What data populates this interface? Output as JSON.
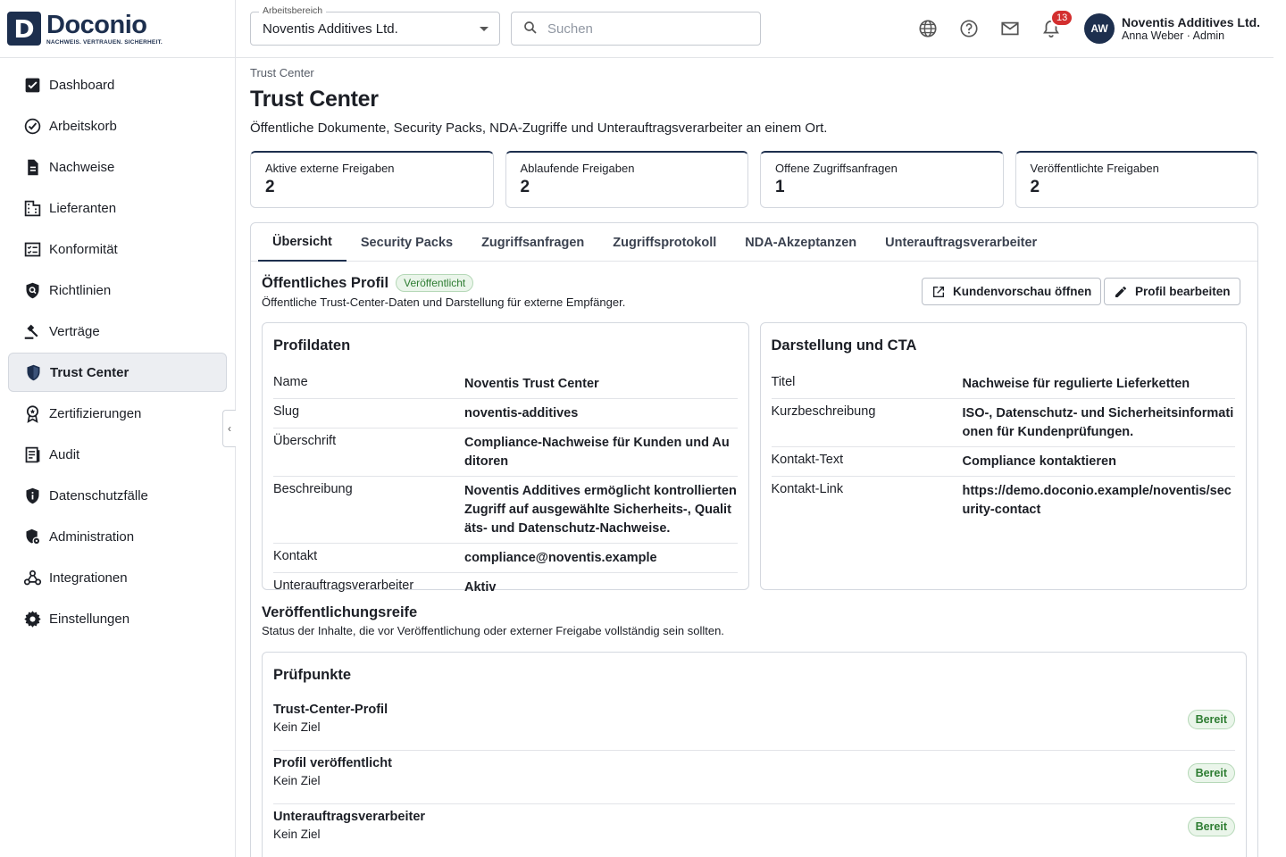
{
  "brand": {
    "mark": "D",
    "name": "Doconio",
    "tagline": "NACHWEIS. VERTRAUEN. SICHERHEIT."
  },
  "header": {
    "workspace_label": "Arbeitsbereich",
    "workspace_value": "Noventis Additives Ltd.",
    "search_placeholder": "Suchen",
    "notifications_count": "13",
    "avatar_initials": "AW",
    "user_org": "Noventis Additives Ltd.",
    "user_name": "Anna Weber · Admin"
  },
  "sidebar": {
    "collapse_glyph": "‹",
    "items": [
      {
        "label": "Dashboard",
        "icon": "dashboard-check-icon"
      },
      {
        "label": "Arbeitskorb",
        "icon": "check-circle-icon"
      },
      {
        "label": "Nachweise",
        "icon": "document-icon"
      },
      {
        "label": "Lieferanten",
        "icon": "building-icon"
      },
      {
        "label": "Konformität",
        "icon": "checklist-icon"
      },
      {
        "label": "Richtlinien",
        "icon": "shield-search-icon"
      },
      {
        "label": "Verträge",
        "icon": "gavel-icon"
      },
      {
        "label": "Trust Center",
        "icon": "shield-icon",
        "active": true
      },
      {
        "label": "Zertifizierungen",
        "icon": "award-icon"
      },
      {
        "label": "Audit",
        "icon": "audit-icon"
      },
      {
        "label": "Datenschutzfälle",
        "icon": "privacy-shield-icon"
      },
      {
        "label": "Administration",
        "icon": "admin-shield-icon"
      },
      {
        "label": "Integrationen",
        "icon": "webhook-icon"
      },
      {
        "label": "Einstellungen",
        "icon": "gear-icon"
      }
    ]
  },
  "page": {
    "breadcrumb": "Trust Center",
    "title": "Trust Center",
    "subtitle": "Öffentliche Dokumente, Security Packs, NDA-Zugriffe und Unterauftragsverarbeiter an einem Ort."
  },
  "stats": [
    {
      "label": "Aktive externe Freigaben",
      "value": "2"
    },
    {
      "label": "Ablaufende Freigaben",
      "value": "2"
    },
    {
      "label": "Offene Zugriffsanfragen",
      "value": "1"
    },
    {
      "label": "Veröffentlichte Freigaben",
      "value": "2"
    }
  ],
  "tabs": [
    "Übersicht",
    "Security Packs",
    "Zugriffsanfragen",
    "Zugriffsprotokoll",
    "NDA-Akzeptanzen",
    "Unterauftragsverarbeiter"
  ],
  "profile": {
    "title": "Öffentliches Profil",
    "status": "Veröffentlicht",
    "subtitle": "Öffentliche Trust-Center-Daten und Darstellung für externe Empfänger.",
    "preview_button": "Kundenvorschau öffnen",
    "edit_button": "Profil bearbeiten"
  },
  "profile_data": {
    "title": "Profildaten",
    "rows": [
      {
        "key": "Name",
        "value": "Noventis Trust Center"
      },
      {
        "key": "Slug",
        "value": "noventis-additives"
      },
      {
        "key": "Überschrift",
        "value": "Compliance-Nachweise für Kunden und Auditoren"
      },
      {
        "key": "Beschreibung",
        "value": "Noventis Additives ermöglicht kontrollierten Zugriff auf ausgewählte Sicherheits-, Qualitäts- und Datenschutz-Nachweise."
      },
      {
        "key": "Kontakt",
        "value": "compliance@noventis.example"
      },
      {
        "key": "Unterauftragsverarbeiter",
        "value": "Aktiv"
      }
    ]
  },
  "presentation": {
    "title": "Darstellung und CTA",
    "rows": [
      {
        "key": "Titel",
        "value": "Nachweise für regulierte Lieferketten"
      },
      {
        "key": "Kurzbeschreibung",
        "value": "ISO-, Datenschutz- und Sicherheitsinformationen für Kundenprüfungen."
      },
      {
        "key": "Kontakt-Text",
        "value": "Compliance kontaktieren"
      },
      {
        "key": "Kontakt-Link",
        "value": "https://demo.doconio.example/noventis/security-contact"
      }
    ]
  },
  "readiness": {
    "title": "Veröffentlichungsreife",
    "subtitle": "Status der Inhalte, die vor Veröffentlichung oder externer Freigabe vollständig sein sollten.",
    "card_title": "Prüfpunkte",
    "items": [
      {
        "name": "Trust-Center-Profil",
        "sub": "Kein Ziel",
        "status": "Bereit"
      },
      {
        "name": "Profil veröffentlicht",
        "sub": "Kein Ziel",
        "status": "Bereit"
      },
      {
        "name": "Unterauftragsverarbeiter",
        "sub": "Kein Ziel",
        "status": "Bereit"
      }
    ]
  },
  "colors": {
    "brand": "#1d2f4e",
    "success": "#2e7d32",
    "badge": "#d32f2f"
  }
}
